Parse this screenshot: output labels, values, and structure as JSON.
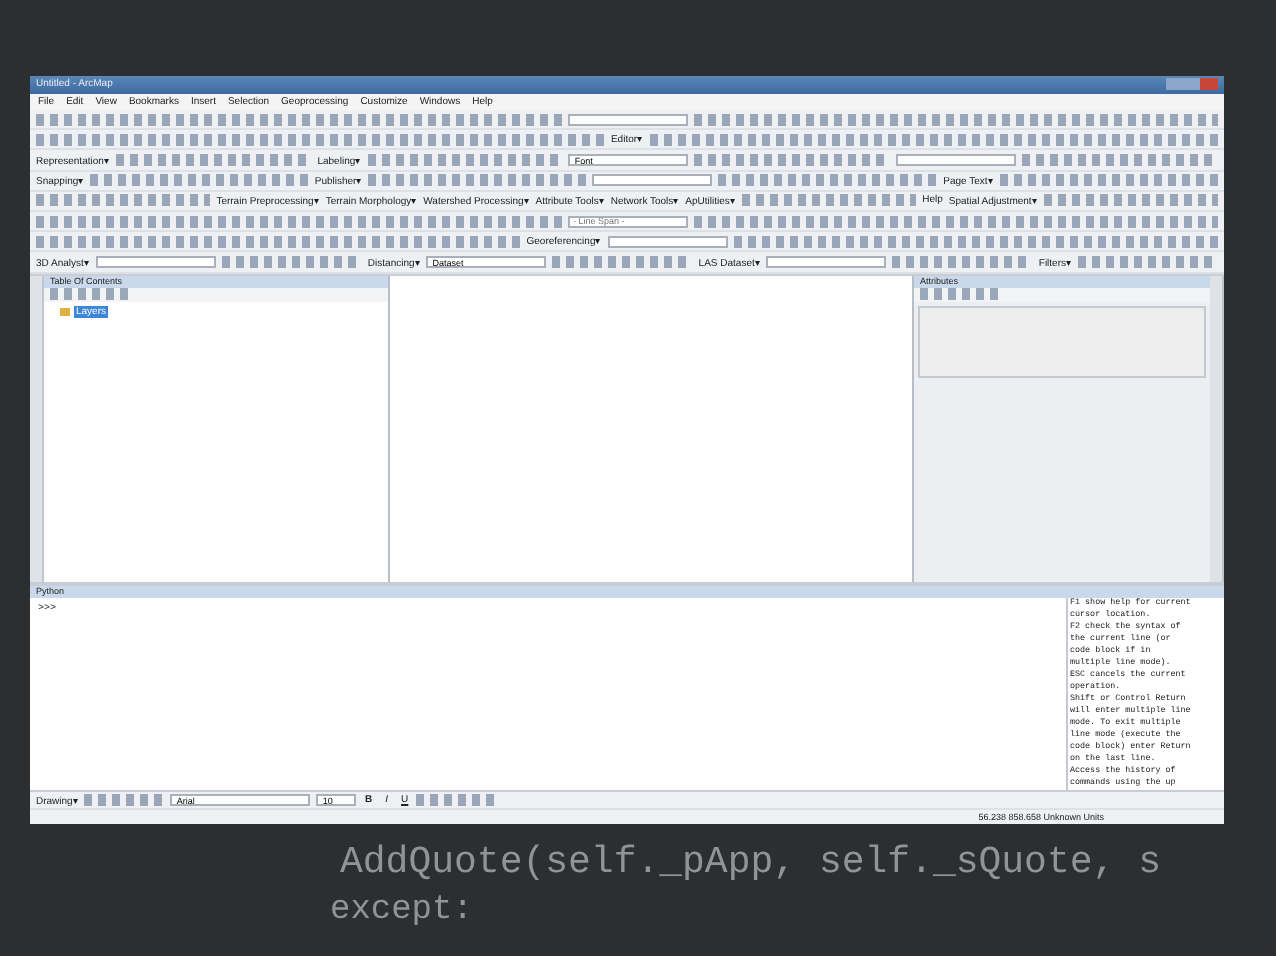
{
  "window": {
    "title": "Untitled - ArcMap"
  },
  "menu": [
    "File",
    "Edit",
    "View",
    "Bookmarks",
    "Insert",
    "Selection",
    "Geoprocessing",
    "Customize",
    "Windows",
    "Help"
  ],
  "toolbars": [
    [
      {
        "kind": "tools"
      },
      {
        "kind": "field"
      },
      {
        "kind": "tools"
      }
    ],
    [
      {
        "kind": "tools"
      },
      {
        "kind": "menu",
        "text": "Editor▾"
      },
      {
        "kind": "tools"
      }
    ],
    [
      {
        "kind": "menu",
        "text": "Representation▾"
      },
      {
        "kind": "tools"
      },
      {
        "kind": "menu",
        "text": "Labeling▾"
      },
      {
        "kind": "tools"
      },
      {
        "kind": "field",
        "value": "Font"
      },
      {
        "kind": "tools"
      },
      {
        "kind": "field"
      },
      {
        "kind": "tools"
      }
    ],
    [
      {
        "kind": "menu",
        "text": "Snapping▾"
      },
      {
        "kind": "tools"
      },
      {
        "kind": "menu",
        "text": "Publisher▾"
      },
      {
        "kind": "tools"
      },
      {
        "kind": "field"
      },
      {
        "kind": "tools"
      },
      {
        "kind": "menu",
        "text": "Page Text▾"
      },
      {
        "kind": "tools"
      }
    ],
    [
      {
        "kind": "tools"
      },
      {
        "kind": "menu",
        "text": "Terrain Preprocessing▾"
      },
      {
        "kind": "menu",
        "text": "Terrain Morphology▾"
      },
      {
        "kind": "menu",
        "text": "Watershed Processing▾"
      },
      {
        "kind": "menu",
        "text": "Attribute Tools▾"
      },
      {
        "kind": "menu",
        "text": "Network Tools▾"
      },
      {
        "kind": "menu",
        "text": "ApUtilities▾"
      },
      {
        "kind": "tools"
      },
      {
        "kind": "menu",
        "text": "Help"
      },
      {
        "kind": "menu",
        "text": "Spatial Adjustment▾"
      },
      {
        "kind": "tools"
      }
    ],
    [
      {
        "kind": "tools"
      },
      {
        "kind": "field",
        "placeholder": "- Line Span -"
      },
      {
        "kind": "tools"
      }
    ],
    [
      {
        "kind": "tools"
      },
      {
        "kind": "menu",
        "text": "Georeferencing▾"
      },
      {
        "kind": "field"
      },
      {
        "kind": "tools"
      }
    ],
    [
      {
        "kind": "menu",
        "text": "3D Analyst▾"
      },
      {
        "kind": "field"
      },
      {
        "kind": "tools"
      },
      {
        "kind": "menu",
        "text": "Distancing▾"
      },
      {
        "kind": "field",
        "value": "Dataset"
      },
      {
        "kind": "tools"
      },
      {
        "kind": "menu",
        "text": "LAS Dataset▾"
      },
      {
        "kind": "field"
      },
      {
        "kind": "tools"
      },
      {
        "kind": "menu",
        "text": "Filters▾"
      },
      {
        "kind": "tools"
      }
    ]
  ],
  "toc": {
    "title": "Table Of Contents",
    "layers": [
      {
        "label": "Layers",
        "selected": true
      }
    ]
  },
  "attributes": {
    "title": "Attributes"
  },
  "python": {
    "title": "Python",
    "prompt": ">>>",
    "help": [
      "F1 show help for current",
      "cursor location.",
      "F2 check the syntax of",
      "the current line (or",
      "code block if in",
      "multiple line mode).",
      "ESC cancels the current",
      "operation.",
      "Shift or Control Return",
      "will enter multiple line",
      "mode.  To exit multiple",
      "line mode (execute the",
      "code block) enter Return",
      "on the last line.",
      "Access the history of",
      "commands using the up"
    ]
  },
  "drawing": {
    "menu": "Drawing▾",
    "font": "Arial",
    "size": "10",
    "styles": [
      "B",
      "I",
      "U"
    ]
  },
  "status_bar": "56.238  858.658 Unknown Units",
  "background_code": [
    "AddQuote(self._pApp, self._sQuote, s",
    "except:"
  ]
}
